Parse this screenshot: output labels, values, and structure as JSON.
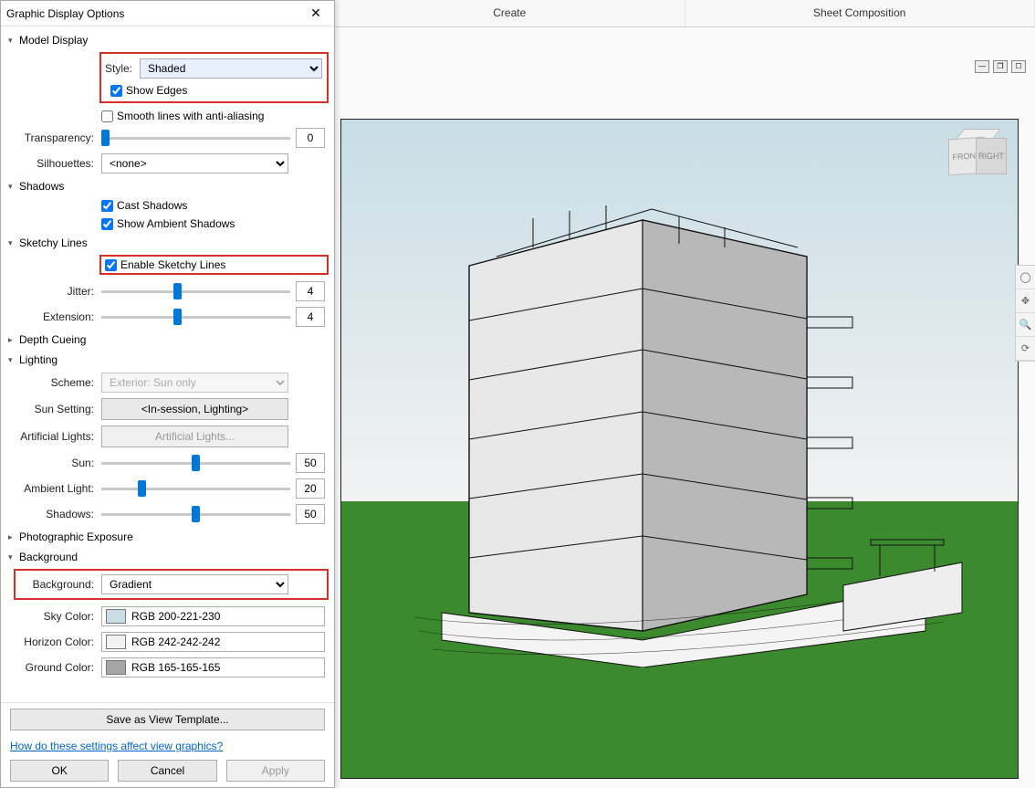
{
  "ribbon": {
    "tab1": "Create",
    "tab2": "Sheet Composition"
  },
  "dialog": {
    "title": "Graphic Display Options"
  },
  "modelDisplay": {
    "title": "Model Display",
    "styleLabel": "Style:",
    "styleValue": "Shaded",
    "showEdges": "Show Edges",
    "smoothLines": "Smooth lines with anti-aliasing",
    "transparencyLabel": "Transparency:",
    "transparencyValue": "0",
    "silhouettesLabel": "Silhouettes:",
    "silhouettesValue": "<none>"
  },
  "shadows": {
    "title": "Shadows",
    "cast": "Cast Shadows",
    "ambient": "Show Ambient Shadows"
  },
  "sketchy": {
    "title": "Sketchy Lines",
    "enable": "Enable Sketchy Lines",
    "jitterLabel": "Jitter:",
    "jitterValue": "4",
    "extensionLabel": "Extension:",
    "extensionValue": "4"
  },
  "depthCueing": {
    "title": "Depth Cueing"
  },
  "lighting": {
    "title": "Lighting",
    "schemeLabel": "Scheme:",
    "schemeValue": "Exterior: Sun only",
    "sunSettingLabel": "Sun Setting:",
    "sunSettingValue": "<In-session, Lighting>",
    "artificialLabel": "Artificial Lights:",
    "artificialBtn": "Artificial Lights...",
    "sunLabel": "Sun:",
    "sunValue": "50",
    "ambientLabel": "Ambient Light:",
    "ambientValue": "20",
    "shadowsLabel": "Shadows:",
    "shadowsValue": "50"
  },
  "photographic": {
    "title": "Photographic Exposure"
  },
  "background": {
    "title": "Background",
    "bgLabel": "Background:",
    "bgValue": "Gradient",
    "skyLabel": "Sky Color:",
    "skyValue": "RGB 200-221-230",
    "skyHex": "#c8dde6",
    "horizonLabel": "Horizon Color:",
    "horizonValue": "RGB 242-242-242",
    "horizonHex": "#f2f2f2",
    "groundLabel": "Ground Color:",
    "groundValue": "RGB 165-165-165",
    "groundHex": "#a5a5a5"
  },
  "footer": {
    "saveTemplate": "Save as View Template...",
    "help": "How do these settings affect view graphics?",
    "ok": "OK",
    "cancel": "Cancel",
    "apply": "Apply"
  },
  "navCube": {
    "front": "FRONT",
    "right": "RIGHT"
  }
}
